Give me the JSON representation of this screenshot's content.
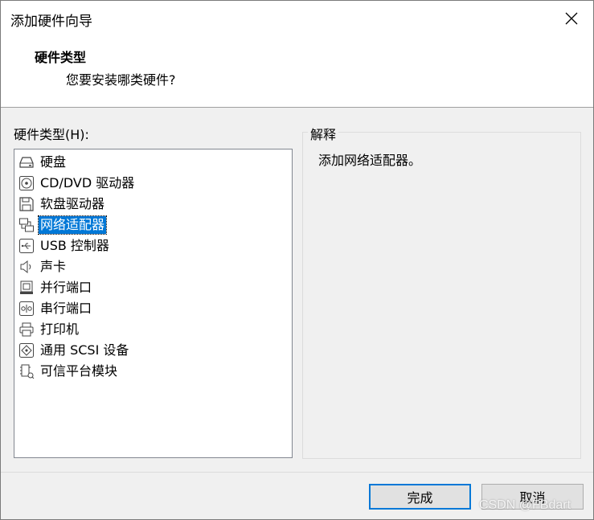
{
  "window": {
    "title": "添加硬件向导"
  },
  "header": {
    "title": "硬件类型",
    "subtitle": "您要安装哪类硬件?"
  },
  "list": {
    "label": "硬件类型(H):",
    "items": [
      {
        "label": "硬盘",
        "icon": "hard-disk-icon"
      },
      {
        "label": "CD/DVD 驱动器",
        "icon": "cd-dvd-icon"
      },
      {
        "label": "软盘驱动器",
        "icon": "floppy-icon"
      },
      {
        "label": "网络适配器",
        "icon": "network-adapter-icon"
      },
      {
        "label": "USB 控制器",
        "icon": "usb-icon"
      },
      {
        "label": "声卡",
        "icon": "speaker-icon"
      },
      {
        "label": "并行端口",
        "icon": "parallel-port-icon"
      },
      {
        "label": "串行端口",
        "icon": "serial-port-icon"
      },
      {
        "label": "打印机",
        "icon": "printer-icon"
      },
      {
        "label": "通用 SCSI 设备",
        "icon": "scsi-icon"
      },
      {
        "label": "可信平台模块",
        "icon": "tpm-icon"
      }
    ],
    "selected": "网络适配器"
  },
  "explanation": {
    "legend": "解释",
    "text": "添加网络适配器。"
  },
  "buttons": {
    "finish": "完成",
    "cancel": "取消"
  },
  "watermark": "CSDN @FBdart",
  "colors": {
    "selection": "#0078d7",
    "primary_border": "#0078d7"
  }
}
